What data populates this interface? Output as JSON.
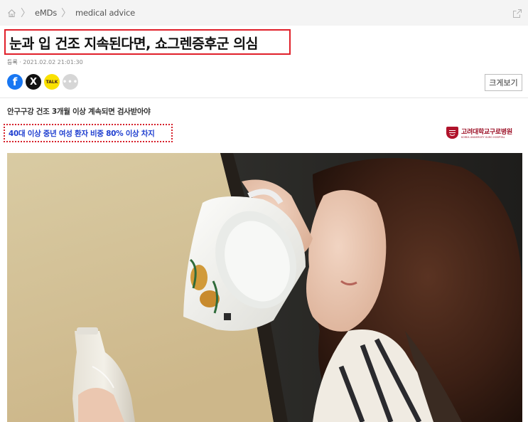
{
  "breadcrumb": {
    "home_icon": "home-icon",
    "items": [
      "eMDs",
      "medical advice"
    ],
    "share_icon": "share-out-icon"
  },
  "article": {
    "headline": "눈과 입 건조 지속된다면, 쇼그렌증후군 의심",
    "date_label": "등록",
    "date": "2021.02.02 21:01:30",
    "subhead": "안구구강 건조 3개월 이상 계속되면 검사받아야",
    "subhead_highlight": "40대 이상 중년 여성 환자 비중 80% 이상 차지"
  },
  "share": {
    "facebook_glyph": "f",
    "x_glyph": "X",
    "kakao_glyph": "TALK",
    "more_glyph": "•••"
  },
  "toolbar": {
    "zoom_label": "크게보기"
  },
  "source": {
    "name_ko": "고려대학교구로병원",
    "name_en": "KOREA UNIVERSITY GURO HOSPITAL",
    "accent": "#9c1026"
  },
  "colors": {
    "headline_border": "#e0202a",
    "subhead_highlight": "#1f3fd0",
    "crumb_bg": "#f4f4f4"
  }
}
